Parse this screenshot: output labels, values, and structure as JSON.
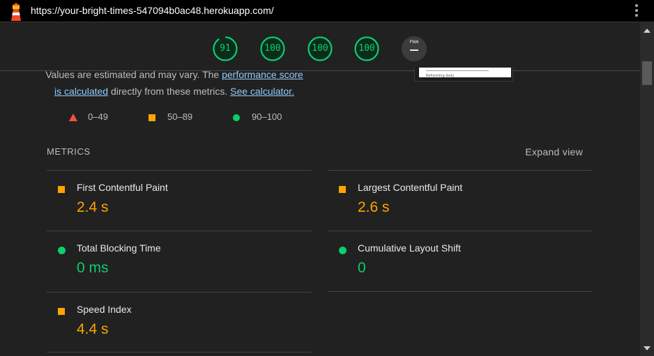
{
  "browser": {
    "url": "https://your-bright-times-547094b0ac48.herokuapp.com/"
  },
  "gauges": [
    {
      "score": "91"
    },
    {
      "score": "100"
    },
    {
      "score": "100"
    },
    {
      "score": "100"
    }
  ],
  "pwa": {
    "label": "PWA",
    "dash": "–"
  },
  "description": {
    "line1_prefix": "Values are estimated and may vary. The ",
    "link_performance_score": "performance score",
    "link_is_calculated": "is calculated",
    "middle": " directly from these metrics. ",
    "link_see_calculator": "See calculator."
  },
  "thumbnail": {
    "caption": "Refreshing daily"
  },
  "legend": {
    "fail": "0–49",
    "average": "50–89",
    "pass": "90–100"
  },
  "metrics_section": {
    "title": "METRICS",
    "expand_label": "Expand view"
  },
  "metrics": {
    "fcp": {
      "label": "First Contentful Paint",
      "value": "2.4 s",
      "rating": "average"
    },
    "lcp": {
      "label": "Largest Contentful Paint",
      "value": "2.6 s",
      "rating": "average"
    },
    "tbt": {
      "label": "Total Blocking Time",
      "value": "0 ms",
      "rating": "pass"
    },
    "cls": {
      "label": "Cumulative Layout Shift",
      "value": "0",
      "rating": "pass"
    },
    "si": {
      "label": "Speed Index",
      "value": "4.4 s",
      "rating": "average"
    }
  },
  "colors": {
    "pass": "#0cce6b",
    "average": "#ffa400",
    "fail": "#ff4e42",
    "link": "#90caf9",
    "background": "#212121"
  }
}
